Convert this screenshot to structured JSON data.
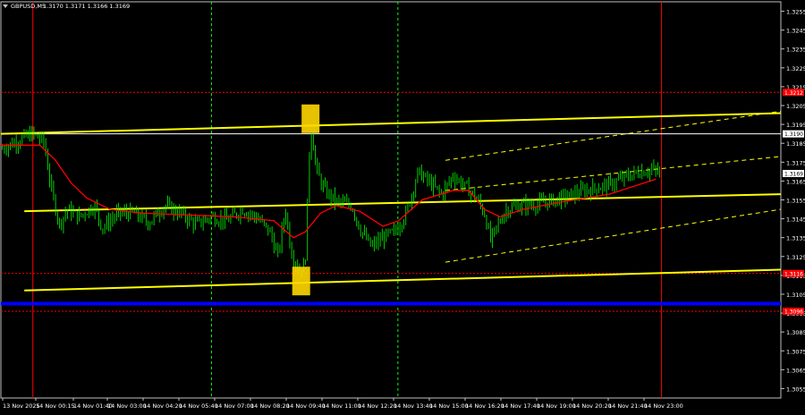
{
  "header": {
    "symbol": "GBPUSD,M5",
    "ohlc": "1.3170 1.3171 1.3166 1.3169"
  },
  "colors": {
    "background": "#000000",
    "candles": "#00ff00",
    "ma": "#ff0000",
    "channel": "#ffff00",
    "level_red": "#ff0000",
    "level_blue": "#0000ff",
    "level_white": "#ffffff",
    "vline_red": "#ff0000",
    "vline_green": "#00ff00",
    "marker": "#ffd700",
    "axis_text": "#ffffff",
    "price_tag": "#ff0000"
  },
  "chart_data": {
    "type": "candlestick",
    "symbol": "GBPUSD",
    "timeframe": "M5",
    "y_ticks": [
      "1.3255",
      "1.3245",
      "1.3235",
      "1.3225",
      "1.3215",
      "1.3205",
      "1.3195",
      "1.3185",
      "1.3175",
      "1.3165",
      "1.3155",
      "1.3145",
      "1.3135",
      "1.3125",
      "1.3115",
      "1.3105",
      "1.3095",
      "1.3085",
      "1.3075",
      "1.3065",
      "1.3055"
    ],
    "ylim": [
      1.305,
      1.326
    ],
    "x_ticks": [
      "13 Nov 2025",
      "14 Nov 00:15",
      "14 Nov 01:40",
      "14 Nov 03:00",
      "14 Nov 04:20",
      "14 Nov 05:40",
      "14 Nov 07:00",
      "14 Nov 08:20",
      "14 Nov 09:40",
      "14 Nov 11:00",
      "14 Nov 12:20",
      "14 Nov 13:40",
      "14 Nov 15:00",
      "14 Nov 16:20",
      "14 Nov 17:40",
      "14 Nov 19:00",
      "14 Nov 20:20",
      "14 Nov 21:40",
      "14 Nov 23:00"
    ],
    "horizontal_levels": [
      {
        "price": 1.3212,
        "color": "red",
        "style": "dotted",
        "tag": "1.3212"
      },
      {
        "price": 1.319,
        "color": "white",
        "style": "solid",
        "tag": "1.3190"
      },
      {
        "price": 1.3116,
        "color": "red",
        "style": "dotted",
        "tag": "1.3116"
      },
      {
        "price": 1.31,
        "color": "blue",
        "style": "solid",
        "tag": ""
      },
      {
        "price": 1.3096,
        "color": "red",
        "style": "dotted",
        "tag": "1.3096"
      }
    ],
    "current_price_tag": "1.3169",
    "vertical_lines": [
      {
        "x_frac": 0.041,
        "color": "red",
        "style": "solid"
      },
      {
        "x_frac": 0.27,
        "color": "green",
        "style": "dashed"
      },
      {
        "x_frac": 0.509,
        "color": "green",
        "style": "dashed"
      },
      {
        "x_frac": 0.847,
        "color": "red",
        "style": "solid"
      }
    ],
    "channel_lines": [
      {
        "from": [
          0.0,
          1.319
        ],
        "to": [
          1.0,
          1.3201
        ],
        "color": "yellow",
        "style": "solid"
      },
      {
        "from": [
          0.03,
          1.3149
        ],
        "to": [
          1.0,
          1.3158
        ],
        "color": "yellow",
        "style": "solid"
      },
      {
        "from": [
          0.03,
          1.3107
        ],
        "to": [
          1.0,
          1.3118
        ],
        "color": "yellow",
        "style": "solid"
      },
      {
        "from": [
          0.57,
          1.3176
        ],
        "to": [
          1.0,
          1.3202
        ],
        "color": "yellow",
        "style": "dashed"
      },
      {
        "from": [
          0.57,
          1.316
        ],
        "to": [
          1.0,
          1.3178
        ],
        "color": "yellow",
        "style": "dashed"
      },
      {
        "from": [
          0.57,
          1.3122
        ],
        "to": [
          1.0,
          1.315
        ],
        "color": "yellow",
        "style": "dashed"
      }
    ],
    "markers": [
      {
        "x_frac": 0.397,
        "price": 1.3198,
        "color": "gold",
        "shape": "square"
      },
      {
        "x_frac": 0.385,
        "price": 1.3112,
        "color": "gold",
        "shape": "square"
      }
    ],
    "price_path": [
      [
        0.0,
        1.3182
      ],
      [
        0.02,
        1.3186
      ],
      [
        0.04,
        1.319
      ],
      [
        0.055,
        1.3186
      ],
      [
        0.065,
        1.316
      ],
      [
        0.075,
        1.3142
      ],
      [
        0.085,
        1.315
      ],
      [
        0.1,
        1.3146
      ],
      [
        0.12,
        1.3152
      ],
      [
        0.13,
        1.314
      ],
      [
        0.15,
        1.3148
      ],
      [
        0.17,
        1.3148
      ],
      [
        0.19,
        1.3143
      ],
      [
        0.21,
        1.3152
      ],
      [
        0.23,
        1.3148
      ],
      [
        0.25,
        1.3142
      ],
      [
        0.27,
        1.3146
      ],
      [
        0.29,
        1.3144
      ],
      [
        0.31,
        1.315
      ],
      [
        0.33,
        1.3145
      ],
      [
        0.345,
        1.3138
      ],
      [
        0.355,
        1.3125
      ],
      [
        0.365,
        1.315
      ],
      [
        0.372,
        1.3128
      ],
      [
        0.382,
        1.3118
      ],
      [
        0.39,
        1.312
      ],
      [
        0.397,
        1.3195
      ],
      [
        0.405,
        1.317
      ],
      [
        0.415,
        1.316
      ],
      [
        0.43,
        1.3154
      ],
      [
        0.45,
        1.3152
      ],
      [
        0.46,
        1.314
      ],
      [
        0.475,
        1.313
      ],
      [
        0.49,
        1.3135
      ],
      [
        0.505,
        1.3138
      ],
      [
        0.52,
        1.3148
      ],
      [
        0.535,
        1.317
      ],
      [
        0.55,
        1.3164
      ],
      [
        0.565,
        1.3158
      ],
      [
        0.58,
        1.3168
      ],
      [
        0.595,
        1.3162
      ],
      [
        0.61,
        1.3156
      ],
      [
        0.62,
        1.3148
      ],
      [
        0.628,
        1.3133
      ],
      [
        0.635,
        1.314
      ],
      [
        0.648,
        1.315
      ],
      [
        0.665,
        1.3152
      ],
      [
        0.69,
        1.3153
      ],
      [
        0.72,
        1.3156
      ],
      [
        0.75,
        1.316
      ],
      [
        0.78,
        1.3163
      ],
      [
        0.8,
        1.3167
      ],
      [
        0.82,
        1.317
      ],
      [
        0.835,
        1.3171
      ],
      [
        0.847,
        1.3169
      ]
    ],
    "ma_path": [
      [
        0.0,
        1.3184
      ],
      [
        0.05,
        1.3184
      ],
      [
        0.07,
        1.3176
      ],
      [
        0.09,
        1.3164
      ],
      [
        0.11,
        1.3156
      ],
      [
        0.14,
        1.315
      ],
      [
        0.18,
        1.3148
      ],
      [
        0.24,
        1.3147
      ],
      [
        0.3,
        1.3146
      ],
      [
        0.35,
        1.3144
      ],
      [
        0.375,
        1.3135
      ],
      [
        0.39,
        1.3138
      ],
      [
        0.41,
        1.3148
      ],
      [
        0.43,
        1.3152
      ],
      [
        0.46,
        1.3149
      ],
      [
        0.49,
        1.3141
      ],
      [
        0.51,
        1.3144
      ],
      [
        0.54,
        1.3155
      ],
      [
        0.58,
        1.316
      ],
      [
        0.6,
        1.316
      ],
      [
        0.62,
        1.315
      ],
      [
        0.64,
        1.3146
      ],
      [
        0.67,
        1.315
      ],
      [
        0.72,
        1.3154
      ],
      [
        0.78,
        1.3158
      ],
      [
        0.84,
        1.3166
      ]
    ]
  }
}
